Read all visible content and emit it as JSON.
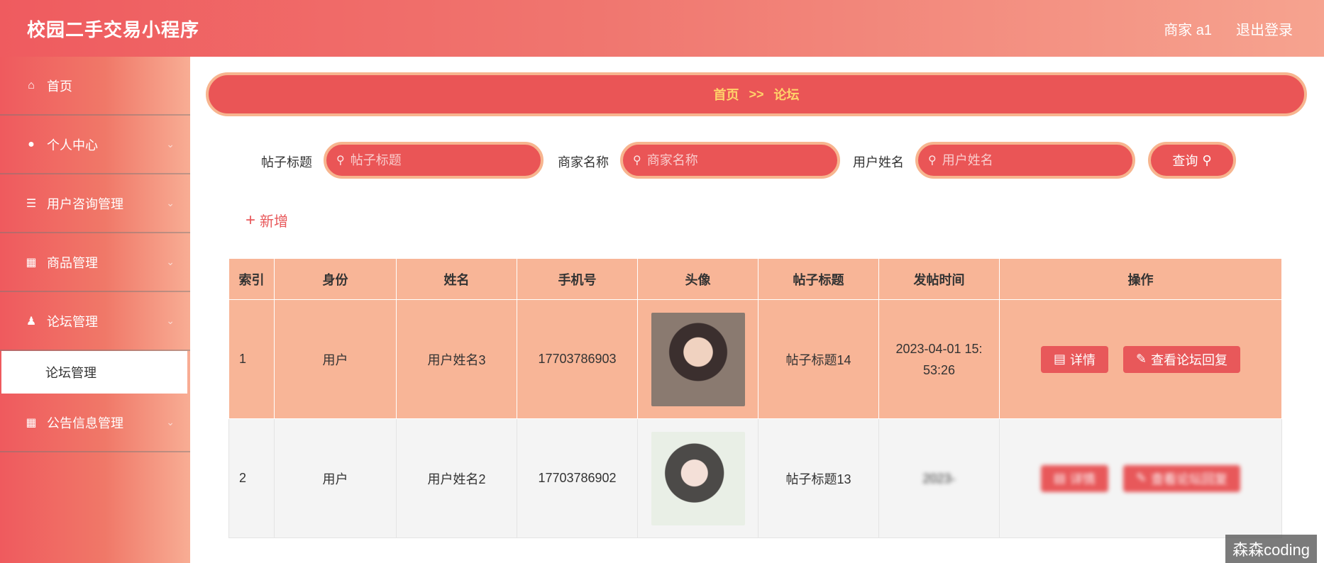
{
  "header": {
    "title": "校园二手交易小程序",
    "user": "商家 a1",
    "logout": "退出登录"
  },
  "sidebar": {
    "items": [
      {
        "label": "首页",
        "icon": "home-icon"
      },
      {
        "label": "个人中心",
        "icon": "user-icon"
      },
      {
        "label": "用户咨询管理",
        "icon": "list-icon"
      },
      {
        "label": "商品管理",
        "icon": "grid-icon"
      },
      {
        "label": "论坛管理",
        "icon": "person-icon"
      },
      {
        "label": "论坛管理",
        "sub": true
      },
      {
        "label": "公告信息管理",
        "icon": "grid-icon"
      }
    ]
  },
  "breadcrumb": {
    "home": "首页",
    "sep": ">>",
    "current": "论坛"
  },
  "search": {
    "title_label": "帖子标题",
    "title_placeholder": "帖子标题",
    "merchant_label": "商家名称",
    "merchant_placeholder": "商家名称",
    "user_label": "用户姓名",
    "user_placeholder": "用户姓名",
    "query_label": "查询"
  },
  "add_label": "新增",
  "table": {
    "headers": [
      "索引",
      "身份",
      "姓名",
      "手机号",
      "头像",
      "帖子标题",
      "发帖时间",
      "操作"
    ],
    "rows": [
      {
        "index": "1",
        "role": "用户",
        "name": "用户姓名3",
        "phone": "17703786903",
        "title": "帖子标题14",
        "time_a": "2023-04-01 15:",
        "time_b": "53:26"
      },
      {
        "index": "2",
        "role": "用户",
        "name": "用户姓名2",
        "phone": "17703786902",
        "title": "帖子标题13",
        "time_a": "2023-",
        "time_b": ""
      }
    ],
    "detail_label": "详情",
    "reply_label": "查看论坛回复"
  },
  "watermark": "森森coding"
}
